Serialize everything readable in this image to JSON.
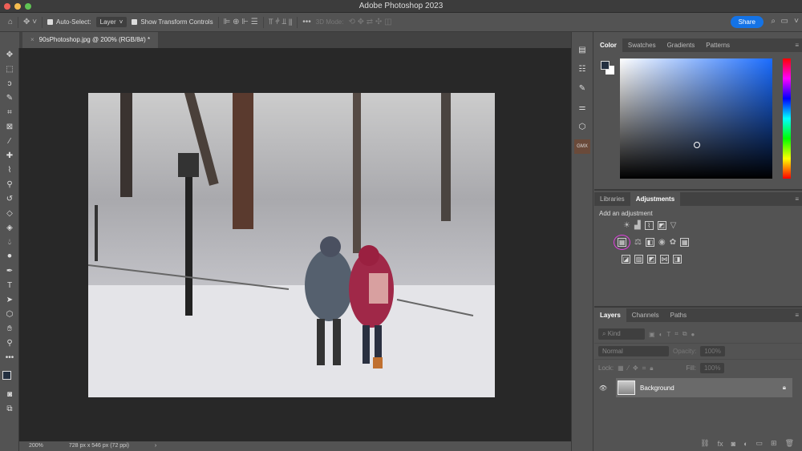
{
  "app_title": "Adobe Photoshop 2023",
  "options": {
    "auto_select_label": "Auto-Select:",
    "auto_select_value": "Layer",
    "show_transform_label": "Show Transform Controls",
    "mode_3d": "3D Mode:",
    "share": "Share"
  },
  "document": {
    "tab_title": "90sPhotoshop.jpg @ 200% (RGB/8#) *",
    "zoom": "200%",
    "info": "728 px x 546 px (72 ppi)"
  },
  "color_panel": {
    "tabs": [
      "Color",
      "Swatches",
      "Gradients",
      "Patterns"
    ]
  },
  "adjustments_panel": {
    "tabs": [
      "Libraries",
      "Adjustments"
    ],
    "heading": "Add an adjustment"
  },
  "layers_panel": {
    "tabs": [
      "Layers",
      "Channels",
      "Paths"
    ],
    "filter": "Kind",
    "blend_mode": "Normal",
    "opacity_label": "Opacity:",
    "opacity": "100%",
    "lock_label": "Lock:",
    "fill_label": "Fill:",
    "fill": "100%",
    "layers": [
      {
        "name": "Background",
        "visible": true,
        "locked": true
      }
    ]
  },
  "colors": {
    "accent": "#1473e6",
    "highlight": "#e040e0"
  }
}
